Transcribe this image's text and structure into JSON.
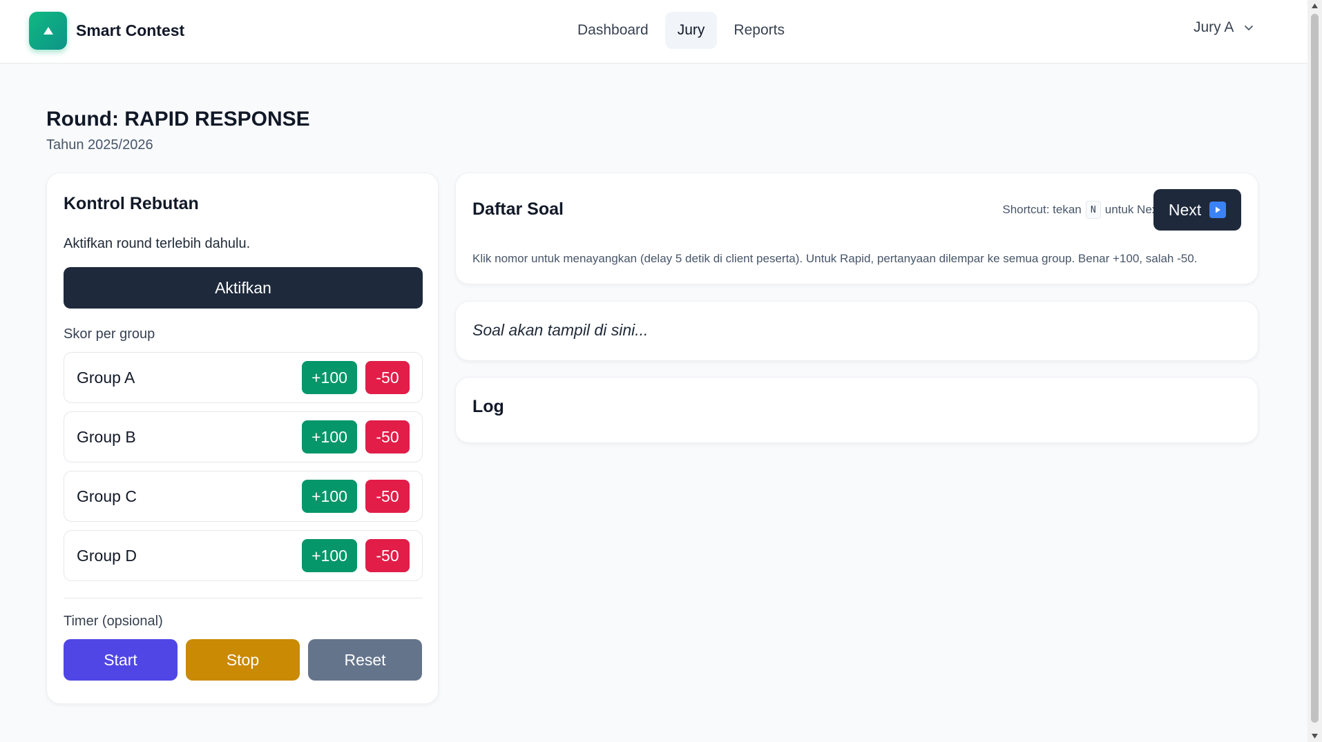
{
  "app": {
    "name": "Smart Contest",
    "logo_icon": "triangle-up-icon",
    "brand_color": "#10b981"
  },
  "nav": {
    "items": [
      {
        "label": "Dashboard",
        "active": false
      },
      {
        "label": "Jury",
        "active": true
      },
      {
        "label": "Reports",
        "active": false
      }
    ]
  },
  "user": {
    "label": "Jury A",
    "icon": "chevron-down-icon"
  },
  "page": {
    "title": "Round: RAPID RESPONSE",
    "subtitle": "Tahun 2025/2026"
  },
  "control": {
    "title": "Kontrol Rebutan",
    "hint": "Aktifkan round terlebih dahulu.",
    "activate_label": "Aktifkan",
    "score_label": "Skor per group",
    "groups": [
      {
        "name": "Group A",
        "plus": "+100",
        "minus": "-50"
      },
      {
        "name": "Group B",
        "plus": "+100",
        "minus": "-50"
      },
      {
        "name": "Group C",
        "plus": "+100",
        "minus": "-50"
      },
      {
        "name": "Group D",
        "plus": "+100",
        "minus": "-50"
      }
    ],
    "timer_label": "Timer (opsional)",
    "timer": {
      "start": "Start",
      "stop": "Stop",
      "reset": "Reset"
    }
  },
  "soal": {
    "title": "Daftar Soal",
    "shortcut_prefix": "Shortcut: tekan",
    "shortcut_key": "N",
    "shortcut_suffix": "untuk Next",
    "next_label": "Next",
    "next_icon": "play-icon",
    "description": "Klik nomor untuk menayangkan (delay 5 detik di client peserta). Untuk Rapid, pertanyaan dilempar ke semua group. Benar +100, salah -50."
  },
  "question": {
    "placeholder": "Soal akan tampil di sini..."
  },
  "log": {
    "title": "Log"
  },
  "colors": {
    "primary_dark": "#1e293b",
    "plus": "#059669",
    "minus": "#e11d48",
    "start": "#4f46e5",
    "stop": "#ca8a04",
    "reset": "#64748b"
  }
}
